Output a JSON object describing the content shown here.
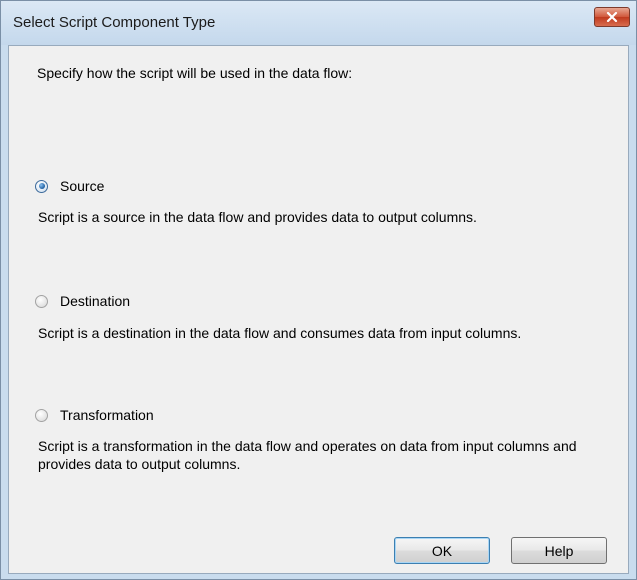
{
  "window": {
    "title": "Select Script Component Type",
    "close_icon": "close-x-icon"
  },
  "dialog": {
    "prompt": "Specify how the script will be used in the data flow:",
    "options": [
      {
        "label": "Source",
        "description": "Script is a source in the data flow and provides data to output columns.",
        "checked": true
      },
      {
        "label": "Destination",
        "description": "Script is a destination in the data flow and consumes data from input columns.",
        "checked": false
      },
      {
        "label": "Transformation",
        "description": "Script is a transformation in the data flow and operates on data from input columns and provides data to output columns.",
        "checked": false
      }
    ]
  },
  "buttons": {
    "ok_label": "OK",
    "help_label": "Help"
  },
  "colors": {
    "frame": "#c9dcee",
    "client_background": "#f0f0f0",
    "close_button": "#c8452a",
    "radio_selected": "#1c5da0"
  }
}
